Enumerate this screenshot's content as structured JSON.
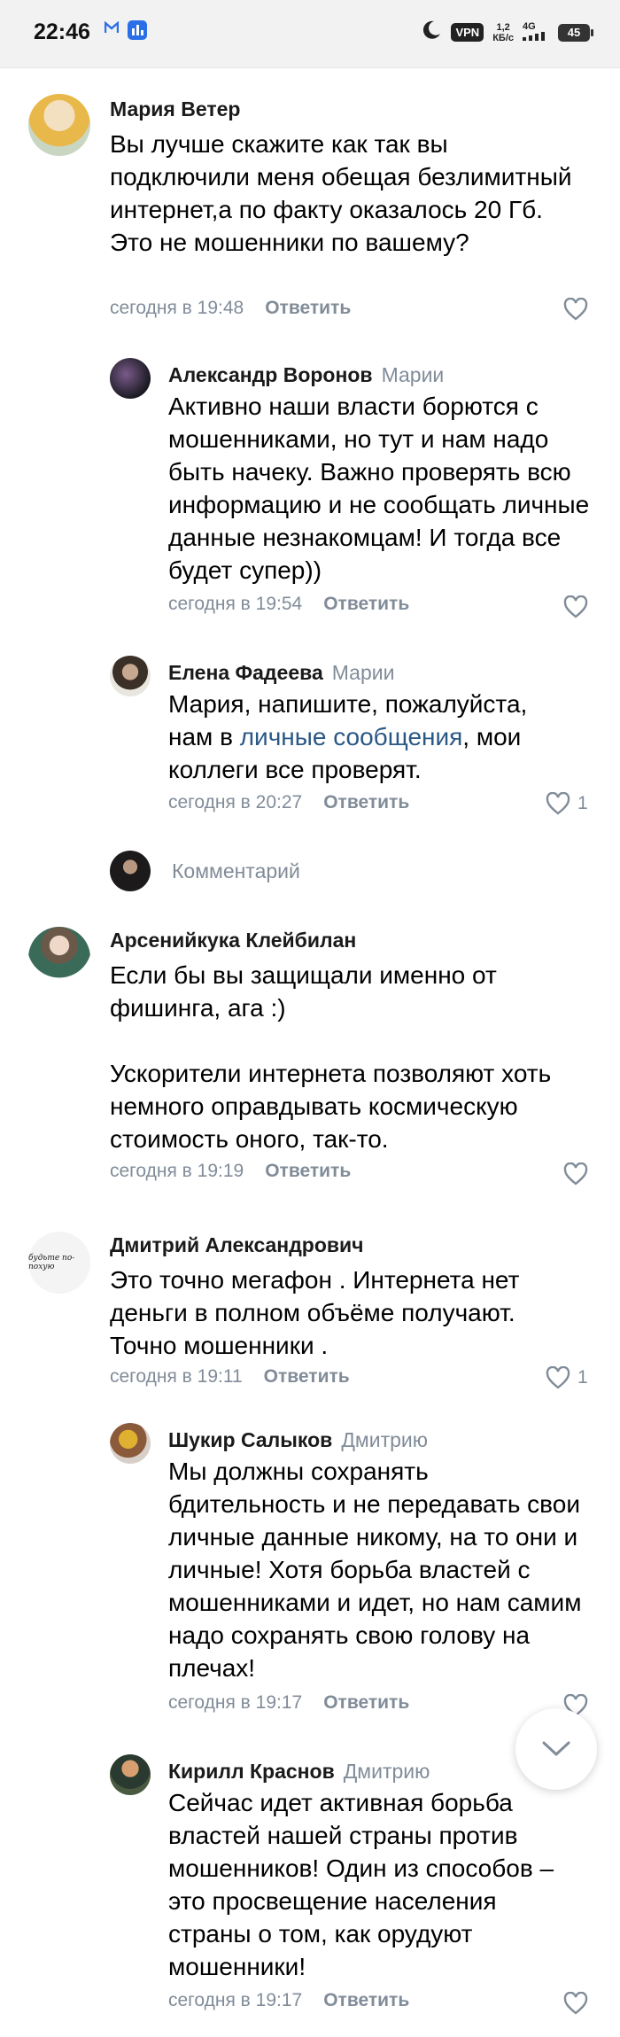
{
  "status_bar": {
    "time": "22:46",
    "vpn": "VPN",
    "speed_top": "1,2",
    "speed_bottom": "КБ/с",
    "network": "4G",
    "battery": "45"
  },
  "comments": [
    {
      "author": "Мария Ветер",
      "reply_to": "",
      "text": "Вы лучше скажите как так вы подключили меня обещая безлимитный интернет,а по факту оказалось 20 Гб. Это не мошенники по вашему?",
      "time": "сегодня в 19:48",
      "reply_label": "Ответить",
      "likes": ""
    },
    {
      "author": "Александр Воронов",
      "reply_to": "Марии",
      "text": "Активно наши власти борются с мошенниками, но тут и нам надо быть начеку. Важно проверять всю информацию и не сообщать личные данные незнакомцам! И тогда все будет супер))",
      "time": "сегодня в 19:54",
      "reply_label": "Ответить",
      "likes": ""
    },
    {
      "author": "Елена Фадеева",
      "reply_to": "Марии",
      "text_before": "Мария, напишите, пожалуйста, нам в ",
      "link_text": "личные сообщения",
      "text_after": ", мои коллеги все проверят.",
      "time": "сегодня в 20:27",
      "reply_label": "Ответить",
      "likes": "1"
    },
    {
      "author": "Арсенийкука Клейбилан",
      "reply_to": "",
      "text_p1": "Если бы вы защищали именно от фишинга, ага :)",
      "text_p2": "Ускорители интернета позволяют хоть немного оправдывать космическую стоимость оного, так-то.",
      "time": "сегодня в 19:19",
      "reply_label": "Ответить",
      "likes": ""
    },
    {
      "author": "Дмитрий Александрович",
      "reply_to": "",
      "avatar_text": "будьте по-похую",
      "text": "Это точно мегафон . Интернета нет деньги в полном объёме получают. Точно мошенники .",
      "time": "сегодня в 19:11",
      "reply_label": "Ответить",
      "likes": "1"
    },
    {
      "author": "Шукир Салыков",
      "reply_to": "Дмитрию",
      "text": "Мы должны сохранять бдительность и не передавать свои личные данные никому, на то они и личные! Хотя борьба властей с мошенниками и идет, но нам самим надо сохранять свою голову на плечах!",
      "time": "сегодня в 19:17",
      "reply_label": "Ответить",
      "likes": ""
    },
    {
      "author": "Кирилл Краснов",
      "reply_to": "Дмитрию",
      "text": "Сейчас идет активная борьба властей нашей страны против мошенников! Один из способов – это просвещение населения страны о том, как орудуют мошенники!",
      "time": "сегодня в 19:17",
      "reply_label": "Ответить",
      "likes": ""
    }
  ],
  "composer": {
    "placeholder": "Комментарий"
  },
  "colors": {
    "secondary": "#818c99",
    "link": "#2a5885"
  }
}
